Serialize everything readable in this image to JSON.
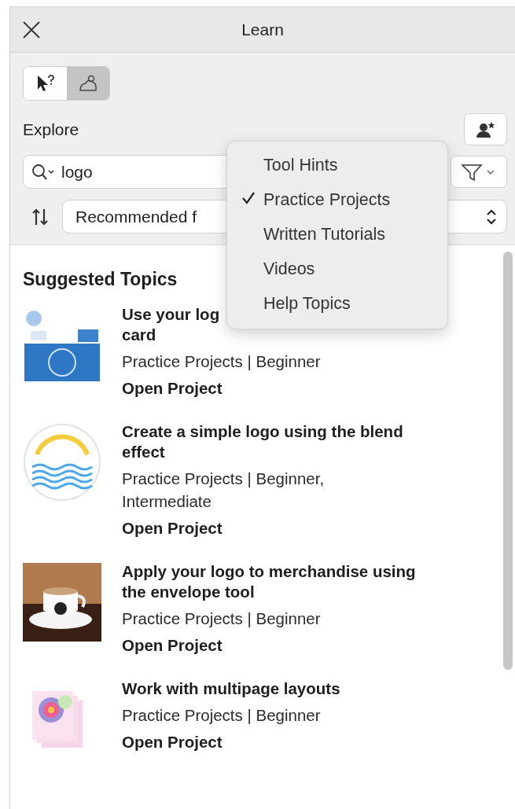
{
  "window": {
    "title": "Learn"
  },
  "modes": [
    {
      "kind": "hints",
      "selected": false
    },
    {
      "kind": "projects",
      "selected": true
    }
  ],
  "explore": {
    "label": "Explore"
  },
  "search": {
    "value": "logo"
  },
  "sort": {
    "value": "Recommended f"
  },
  "menu": [
    {
      "label": "Tool Hints",
      "checked": false
    },
    {
      "label": "Practice Projects",
      "checked": true
    },
    {
      "label": "Written Tutorials",
      "checked": false
    },
    {
      "label": "Videos",
      "checked": false
    },
    {
      "label": "Help Topics",
      "checked": false
    }
  ],
  "section": {
    "title": "Suggested Topics"
  },
  "items": [
    {
      "title": "Use your log\ncard",
      "meta": "Practice Projects | Beginner",
      "action": "Open Project"
    },
    {
      "title": "Create a simple logo using the blend effect",
      "meta": "Practice Projects | Beginner, Intermediate",
      "action": "Open Project"
    },
    {
      "title": "Apply your logo to merchandise using the envelope tool",
      "meta": "Practice Projects | Beginner",
      "action": "Open Project"
    },
    {
      "title": "Work with multipage layouts",
      "meta": "Practice Projects | Beginner",
      "action": "Open Project"
    }
  ]
}
